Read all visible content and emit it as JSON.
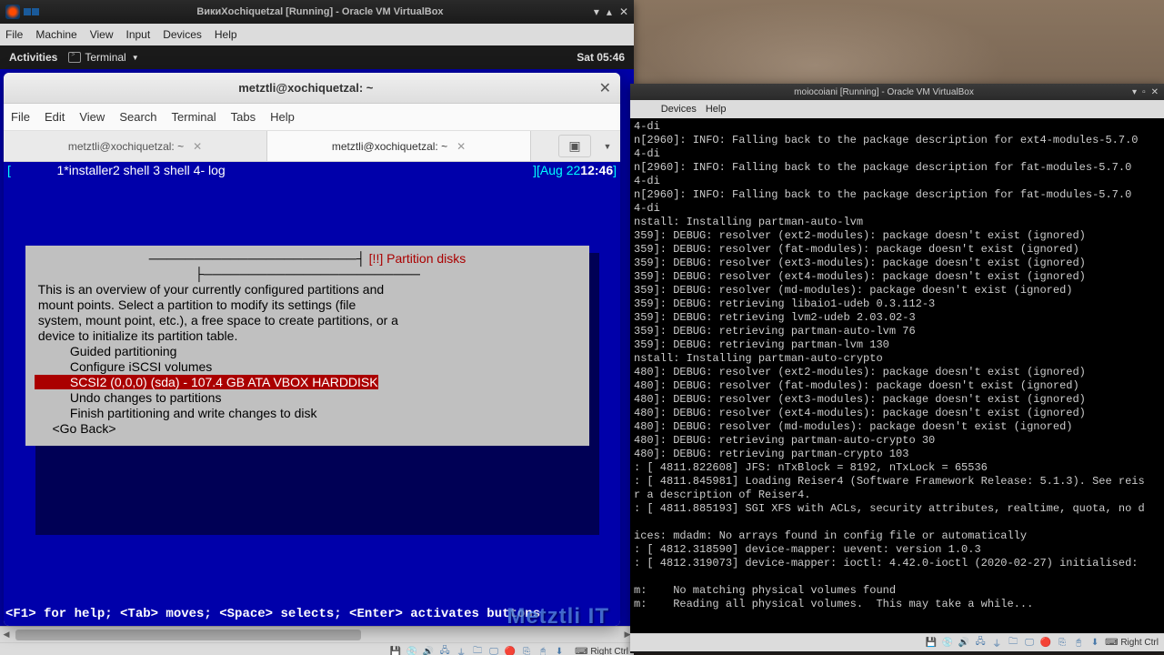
{
  "vm1": {
    "title": "ВикиXochiquetzal [Running] - Oracle VM VirtualBox",
    "menu": [
      "File",
      "Machine",
      "View",
      "Input",
      "Devices",
      "Help"
    ],
    "gnome": {
      "activities": "Activities",
      "app": "Terminal",
      "clock": "Sat 05:46"
    },
    "terminal": {
      "title": "metztli@xochiquetzal: ~",
      "menu": [
        "File",
        "Edit",
        "View",
        "Search",
        "Terminal",
        "Tabs",
        "Help"
      ],
      "tabs": [
        {
          "label": "metztli@xochiquetzal: ~",
          "active": false
        },
        {
          "label": "metztli@xochiquetzal: ~",
          "active": true
        }
      ],
      "tmux": {
        "left_l": "[",
        "sessions": "1*installer",
        "rest": "  2 shell  3 shell  4- log",
        "rb": "][",
        "date": " Aug 22 ",
        "time": "12:46",
        "rb2": "]"
      },
      "dialog": {
        "title": "[!!] Partition disks",
        "body": [
          " This is an overview of your currently configured partitions and",
          " mount points. Select a partition to modify its settings (file",
          " system, mount point, etc.), a free space to create partitions, or a",
          " device to initialize its partition table.",
          "",
          "          Guided partitioning",
          "          Configure iSCSI volumes",
          ""
        ],
        "selected": "          SCSI2 (0,0,0) (sda) - 107.4 GB ATA VBOX HARDDISK",
        "body2": [
          "",
          "          Undo changes to partitions",
          "          Finish partitioning and write changes to disk",
          "",
          "     <Go Back>",
          ""
        ]
      },
      "help": "<F1> for help; <Tab> moves; <Space> selects; <Enter> activates buttons",
      "watermark": "Metztli IT"
    },
    "hostkey": "Right Ctrl"
  },
  "vm2": {
    "title": "moiocoiani [Running] - Oracle VM VirtualBox",
    "menu_visible": [
      "Devices",
      "Help"
    ],
    "hostkey": "Right Ctrl",
    "log": [
      "4-di",
      "n[2960]: INFO: Falling back to the package description for ext4-modules-5.7.0",
      "4-di",
      "n[2960]: INFO: Falling back to the package description for fat-modules-5.7.0",
      "4-di",
      "n[2960]: INFO: Falling back to the package description for fat-modules-5.7.0",
      "4-di",
      "nstall: Installing partman-auto-lvm",
      "359]: DEBUG: resolver (ext2-modules): package doesn't exist (ignored)",
      "359]: DEBUG: resolver (fat-modules): package doesn't exist (ignored)",
      "359]: DEBUG: resolver (ext3-modules): package doesn't exist (ignored)",
      "359]: DEBUG: resolver (ext4-modules): package doesn't exist (ignored)",
      "359]: DEBUG: resolver (md-modules): package doesn't exist (ignored)",
      "359]: DEBUG: retrieving libaio1-udeb 0.3.112-3",
      "359]: DEBUG: retrieving lvm2-udeb 2.03.02-3",
      "359]: DEBUG: retrieving partman-auto-lvm 76",
      "359]: DEBUG: retrieving partman-lvm 130",
      "nstall: Installing partman-auto-crypto",
      "480]: DEBUG: resolver (ext2-modules): package doesn't exist (ignored)",
      "480]: DEBUG: resolver (fat-modules): package doesn't exist (ignored)",
      "480]: DEBUG: resolver (ext3-modules): package doesn't exist (ignored)",
      "480]: DEBUG: resolver (ext4-modules): package doesn't exist (ignored)",
      "480]: DEBUG: resolver (md-modules): package doesn't exist (ignored)",
      "480]: DEBUG: retrieving partman-auto-crypto 30",
      "480]: DEBUG: retrieving partman-crypto 103",
      ": [ 4811.822608] JFS: nTxBlock = 8192, nTxLock = 65536",
      ": [ 4811.845981] Loading Reiser4 (Software Framework Release: 5.1.3). See reis",
      "r a description of Reiser4.",
      ": [ 4811.885193] SGI XFS with ACLs, security attributes, realtime, quota, no d",
      "",
      "ices: mdadm: No arrays found in config file or automatically",
      ": [ 4812.318590] device-mapper: uevent: version 1.0.3",
      ": [ 4812.319073] device-mapper: ioctl: 4.42.0-ioctl (2020-02-27) initialised:",
      "",
      "m:    No matching physical volumes found",
      "m:    Reading all physical volumes.  This may take a while..."
    ]
  }
}
